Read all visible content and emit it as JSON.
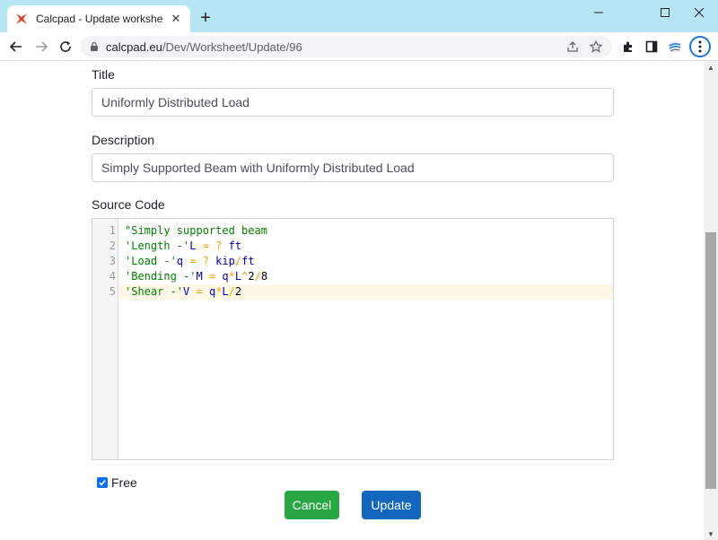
{
  "browser": {
    "tab_title": "Calcpad - Update worksheet: Uni",
    "tab_close": "✕",
    "new_tab": "+",
    "url_host": "calcpad.eu",
    "url_path": "/Dev/Worksheet/Update/96",
    "win_min": "—",
    "win_max": "☐",
    "win_close": "✕"
  },
  "form": {
    "title_label": "Title",
    "title_value": "Uniformly Distributed Load",
    "description_label": "Description",
    "description_value": "Simply Supported Beam with Uniformly Distributed Load",
    "source_label": "Source Code",
    "code_lines": [
      {
        "num": "1",
        "tokens": [
          {
            "t": "\"Simply supported beam",
            "c": "c-str"
          }
        ]
      },
      {
        "num": "2",
        "tokens": [
          {
            "t": "'Length -'",
            "c": "c-str"
          },
          {
            "t": "L",
            "c": "c-var"
          },
          {
            "t": " = ",
            "c": "c-op"
          },
          {
            "t": "?",
            "c": "c-op"
          },
          {
            "t": " ft",
            "c": "c-unit"
          }
        ]
      },
      {
        "num": "3",
        "tokens": [
          {
            "t": "'Load -'",
            "c": "c-str"
          },
          {
            "t": "q",
            "c": "c-var"
          },
          {
            "t": " = ",
            "c": "c-op"
          },
          {
            "t": "?",
            "c": "c-op"
          },
          {
            "t": " kip",
            "c": "c-unit"
          },
          {
            "t": "/",
            "c": "c-op"
          },
          {
            "t": "ft",
            "c": "c-unit"
          }
        ]
      },
      {
        "num": "4",
        "tokens": [
          {
            "t": "'Bending -'",
            "c": "c-str"
          },
          {
            "t": "M",
            "c": "c-var"
          },
          {
            "t": " = ",
            "c": "c-op"
          },
          {
            "t": "q",
            "c": "c-var"
          },
          {
            "t": "*",
            "c": "c-op"
          },
          {
            "t": "L",
            "c": "c-var"
          },
          {
            "t": "^",
            "c": "c-op"
          },
          {
            "t": "2",
            "c": "c-num"
          },
          {
            "t": "/",
            "c": "c-op"
          },
          {
            "t": "8",
            "c": "c-num"
          }
        ]
      },
      {
        "num": "5",
        "tokens": [
          {
            "t": "'Shear -'",
            "c": "c-str"
          },
          {
            "t": "V",
            "c": "c-var"
          },
          {
            "t": " = ",
            "c": "c-op"
          },
          {
            "t": "q",
            "c": "c-var"
          },
          {
            "t": "*",
            "c": "c-op"
          },
          {
            "t": "L",
            "c": "c-var"
          },
          {
            "t": "/",
            "c": "c-op"
          },
          {
            "t": "2",
            "c": "c-num"
          }
        ]
      }
    ],
    "free_label": "Free",
    "free_checked": true,
    "cancel_label": "Cancel",
    "update_label": "Update"
  },
  "colors": {
    "cancel": "#28a745",
    "update": "#1266bd",
    "checkbox": "#0d6efd",
    "tabbar": "#b8e5f3"
  }
}
